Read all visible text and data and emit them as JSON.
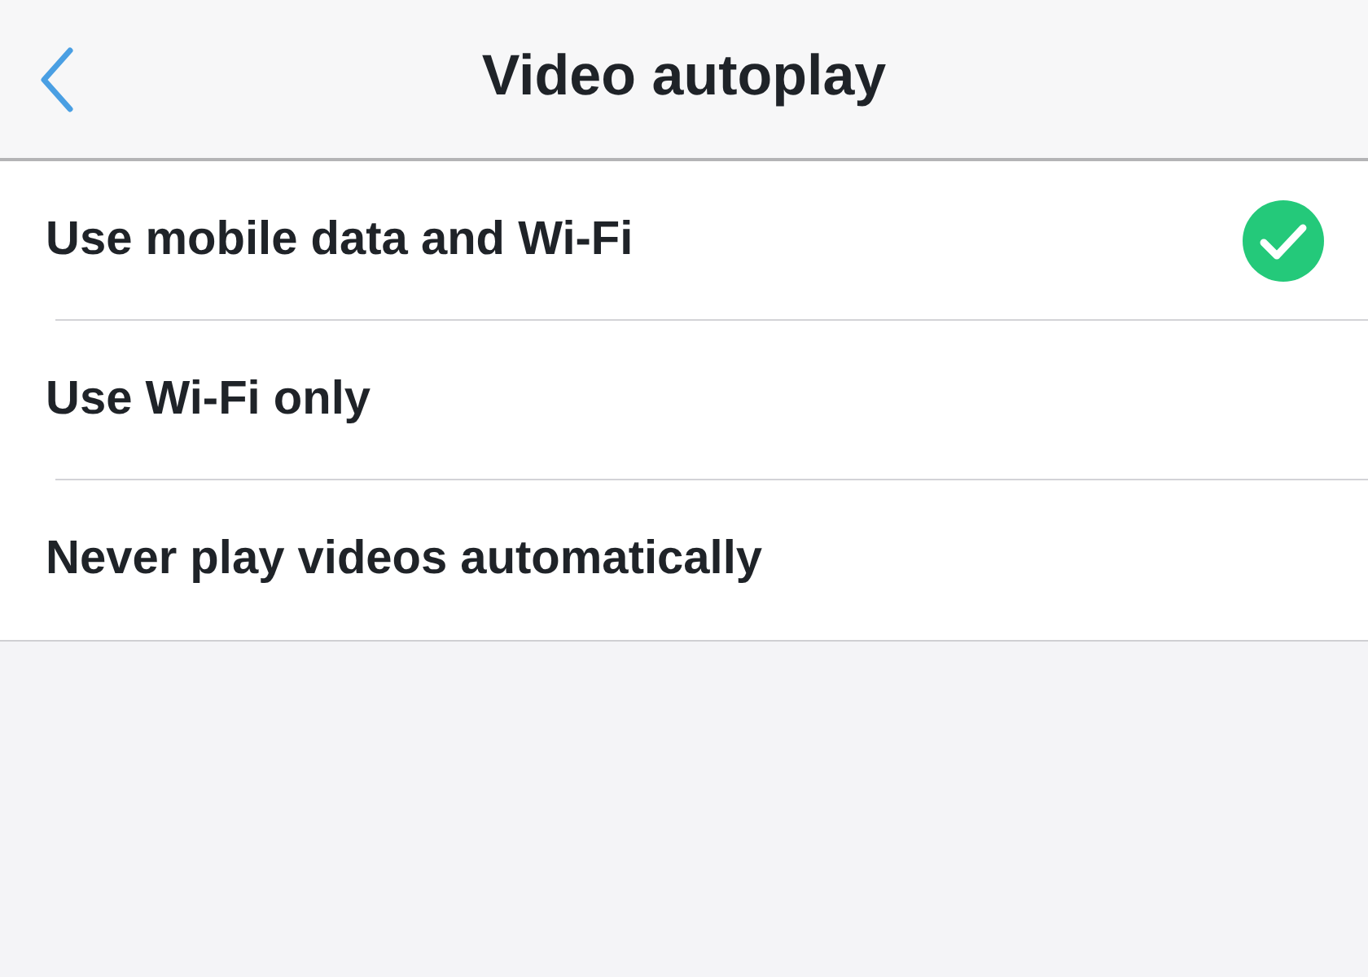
{
  "nav": {
    "title": "Video autoplay"
  },
  "options": [
    {
      "label": "Use mobile data and Wi-Fi",
      "selected": true
    },
    {
      "label": "Use Wi-Fi only",
      "selected": false
    },
    {
      "label": "Never play videos automatically",
      "selected": false
    }
  ]
}
